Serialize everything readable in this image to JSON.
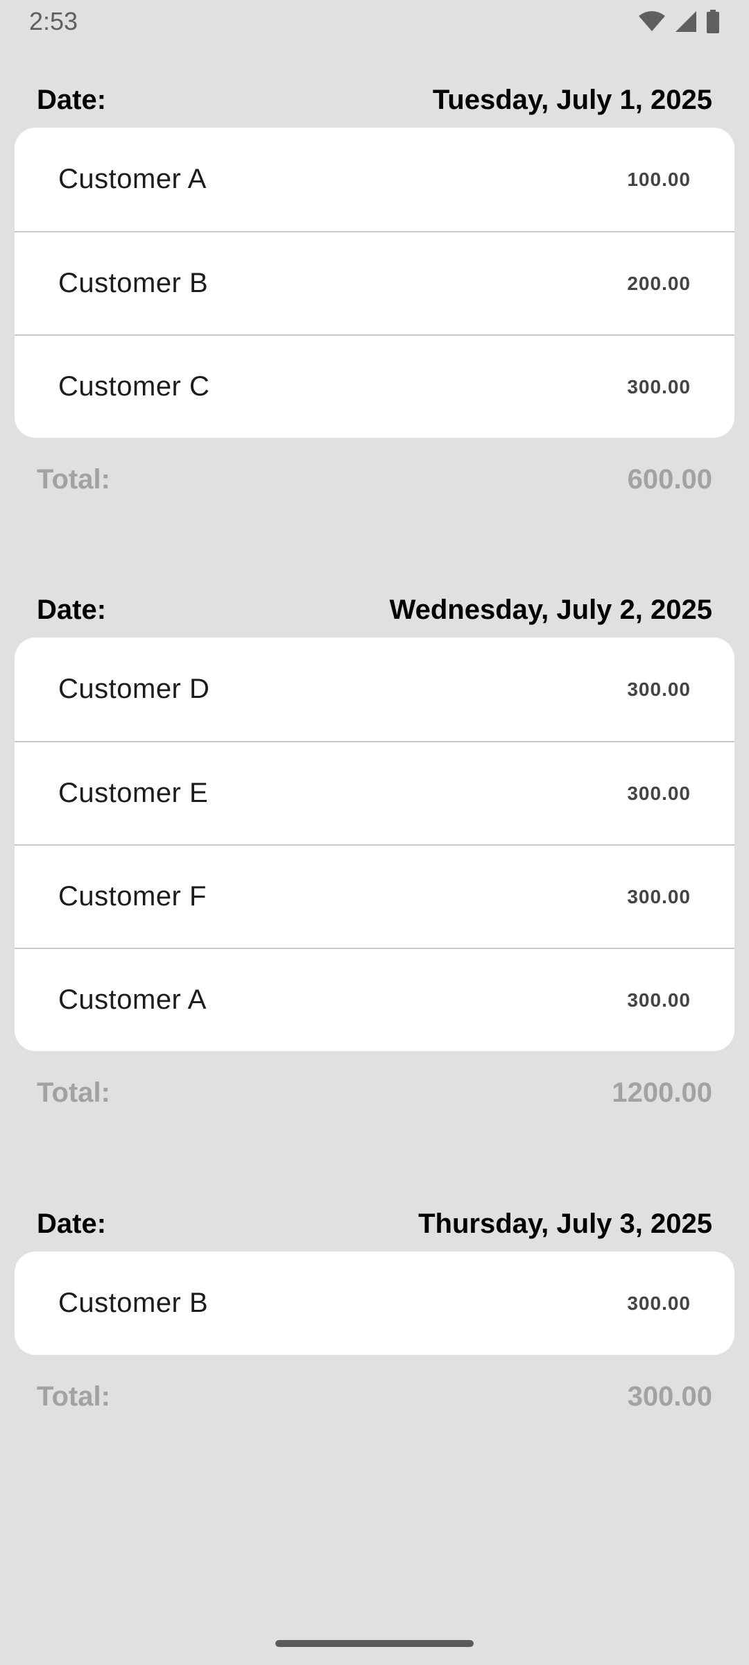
{
  "status_bar": {
    "time": "2:53",
    "icons": [
      "wifi-icon",
      "cellular-signal-icon",
      "battery-icon"
    ]
  },
  "groups": [
    {
      "date_label": "Date:",
      "date_value": "Tuesday, July 1, 2025",
      "rows": [
        {
          "name": "Customer A",
          "amount": "100.00"
        },
        {
          "name": "Customer B",
          "amount": "200.00"
        },
        {
          "name": "Customer C",
          "amount": "300.00"
        }
      ],
      "total_label": "Total:",
      "total_value": "600.00"
    },
    {
      "date_label": "Date:",
      "date_value": "Wednesday, July 2, 2025",
      "rows": [
        {
          "name": "Customer D",
          "amount": "300.00"
        },
        {
          "name": "Customer E",
          "amount": "300.00"
        },
        {
          "name": "Customer F",
          "amount": "300.00"
        },
        {
          "name": "Customer A",
          "amount": "300.00"
        }
      ],
      "total_label": "Total:",
      "total_value": "1200.00"
    },
    {
      "date_label": "Date:",
      "date_value": "Thursday, July 3, 2025",
      "rows": [
        {
          "name": "Customer B",
          "amount": "300.00"
        }
      ],
      "total_label": "Total:",
      "total_value": "300.00"
    }
  ],
  "colors": {
    "background": "#e0e0e0",
    "card": "#ffffff",
    "total_text": "#a2a2a2"
  }
}
